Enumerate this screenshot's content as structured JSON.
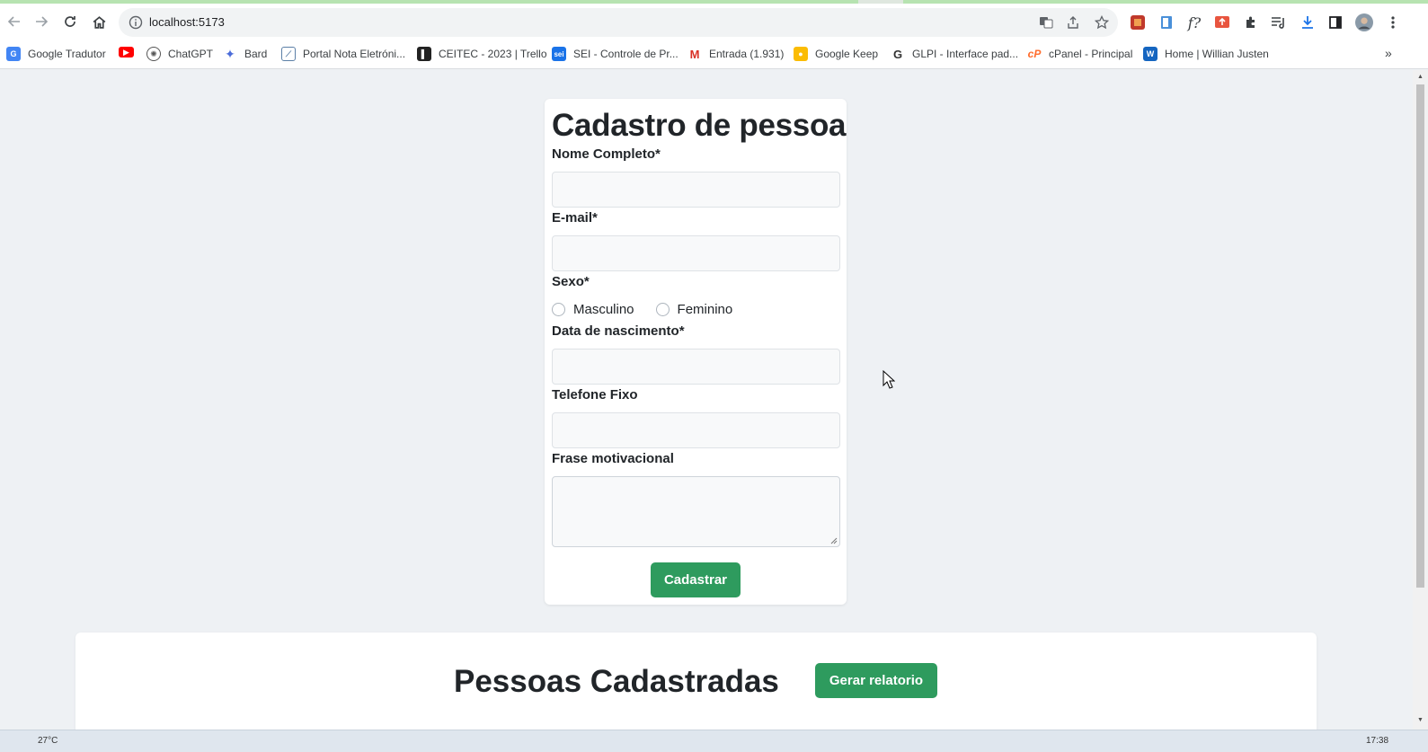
{
  "browser": {
    "url": "localhost:5173",
    "bookmarks": [
      {
        "label": "Google Tradutor",
        "icon": "google-translate-icon",
        "color": "#4285f4"
      },
      {
        "label": "",
        "icon": "youtube-icon",
        "color": "#ff0000"
      },
      {
        "label": "ChatGPT",
        "icon": "chatgpt-icon",
        "color": "#555555"
      },
      {
        "label": "Bard",
        "icon": "bard-icon",
        "color": "#4b6cd9"
      },
      {
        "label": "Portal Nota Eletróni...",
        "icon": "chart-icon",
        "color": "#5b7fa6"
      },
      {
        "label": "CEITEC - 2023 | Trello",
        "icon": "trello-icon",
        "color": "#222222"
      },
      {
        "label": "SEI - Controle de Pr...",
        "icon": "sei-icon",
        "color": "#1a73e8"
      },
      {
        "label": "Entrada (1.931)",
        "icon": "gmail-icon",
        "color": "#d93025"
      },
      {
        "label": "Google Keep",
        "icon": "google-keep-icon",
        "color": "#fbbc04"
      },
      {
        "label": "GLPI - Interface pad...",
        "icon": "glpi-icon",
        "color": "#333333"
      },
      {
        "label": "cPanel - Principal",
        "icon": "cpanel-icon",
        "color": "#ff6c2c"
      },
      {
        "label": "Home | Willian Justen",
        "icon": "w-icon",
        "color": "#1565c0"
      }
    ],
    "more_glyph": "»"
  },
  "form": {
    "title": "Cadastro de pessoa",
    "name_label": "Nome Completo*",
    "email_label": "E-mail*",
    "sex_label": "Sexo*",
    "sex_options": [
      "Masculino",
      "Feminino"
    ],
    "birth_label": "Data de nascimento*",
    "phone_label": "Telefone Fixo",
    "phrase_label": "Frase motivacional",
    "submit_label": "Cadastrar"
  },
  "list": {
    "title": "Pessoas Cadastradas",
    "report_label": "Gerar relatorio"
  },
  "taskbar": {
    "weather": "27°C",
    "clock": "17:38"
  },
  "colors": {
    "primary_button": "#2e9b5e",
    "page_bg": "#eef1f4"
  }
}
